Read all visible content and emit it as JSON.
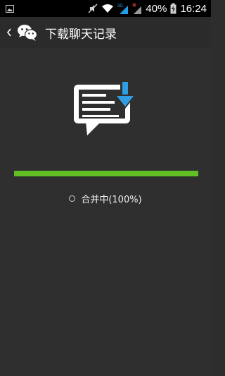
{
  "status_bar": {
    "battery": "40%",
    "time": "16:24",
    "network_label": "3G",
    "icons": [
      "image-icon",
      "mute-icon",
      "wifi-icon",
      "cell-signal-3g-icon",
      "cell-signal-no-service-icon",
      "battery-charging-icon"
    ]
  },
  "header": {
    "title": "下载聊天记录",
    "back_icon": "chevron-left-icon",
    "logo_icon": "wechat-logo-icon"
  },
  "main": {
    "illustration_icon": "chat-download-icon",
    "progress_fraction": 1.0,
    "status_text": "合并中(100%)"
  },
  "colors": {
    "progress": "#5fbf24",
    "download_arrow": "#2f9ee2",
    "background": "#2f2f2f",
    "status_bar": "#000000"
  }
}
